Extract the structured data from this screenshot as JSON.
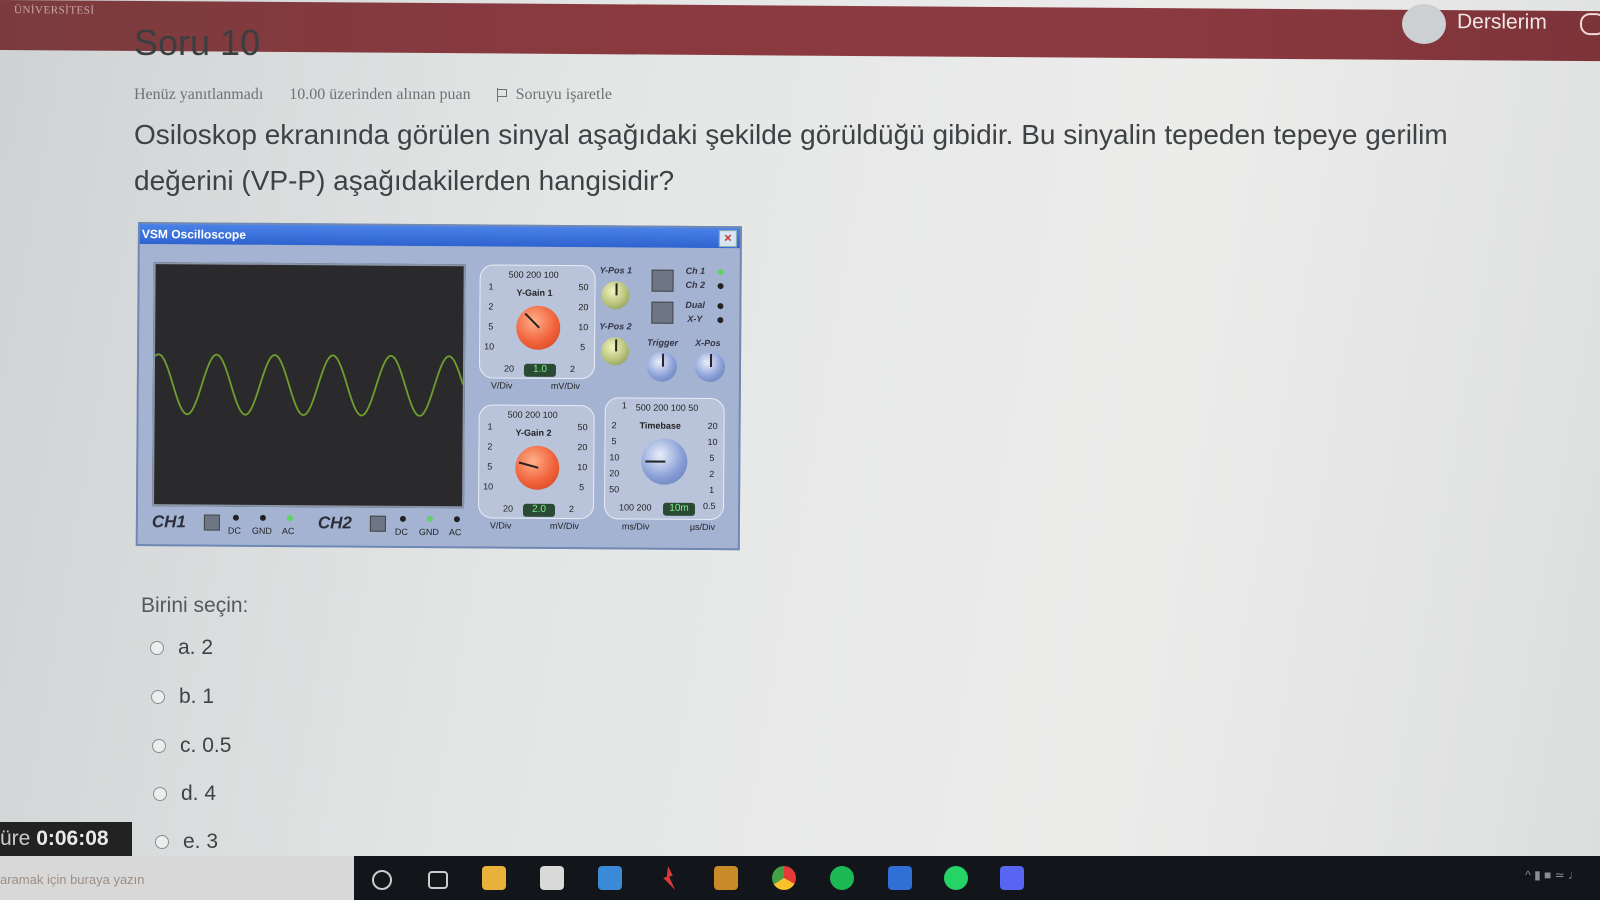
{
  "header": {
    "brand": "ÜNİVERSİTESİ",
    "user_menu": "Derslerim"
  },
  "question": {
    "title": "Soru 10",
    "status": "Henüz yanıtlanmadı",
    "points": "10.00 üzerinden alınan puan",
    "flag_label": "Soruyu işaretle",
    "text": "Osiloskop ekranında görülen sinyal aşağıdaki şekilde görüldüğü gibidir. Bu sinyalin tepeden tepeye gerilim değerini (VP-P) aşağıdakilerden hangisidir?"
  },
  "oscilloscope": {
    "title": "VSM Oscilloscope",
    "close": "×",
    "ch1_label": "CH1",
    "ch2_label": "CH2",
    "coupling": [
      "DC",
      "GND",
      "AC"
    ],
    "ygain1": {
      "label": "Y-Gain 1",
      "top_scale": "500 200 100",
      "left_ticks": [
        "1",
        "2",
        "5",
        "10",
        "20"
      ],
      "right_ticks": [
        "50",
        "20",
        "10",
        "5",
        "2"
      ],
      "readout": "1.0",
      "units_left": "V/Div",
      "units_right": "mV/Div"
    },
    "ygain2": {
      "label": "Y-Gain 2",
      "top_scale": "500 200 100",
      "left_ticks": [
        "1",
        "2",
        "5",
        "10",
        "20"
      ],
      "right_ticks": [
        "50",
        "20",
        "10",
        "5",
        "2"
      ],
      "readout": "2.0",
      "units_left": "V/Div",
      "units_right": "mV/Div"
    },
    "timebase": {
      "label": "Timebase",
      "top_scale": "500 200 100 50",
      "left_ticks": [
        "1",
        "2",
        "5",
        "10",
        "20",
        "50"
      ],
      "right_ticks": [
        "20",
        "10",
        "5",
        "2",
        "1",
        "0.5"
      ],
      "bottom_scale": "100 200",
      "readout": "10m",
      "units_left": "ms/Div",
      "units_right": "µs/Div"
    },
    "ypos1": "Y-Pos 1",
    "ypos2": "Y-Pos 2",
    "ch1_sel": "Ch 1",
    "ch2_sel": "Ch 2",
    "dual": "Dual",
    "xy": "X-Y",
    "trigger": "Trigger",
    "xpos": "X-Pos",
    "waveform_color": "#6f9e2f"
  },
  "answers": {
    "prompt": "Birini seçin:",
    "options": [
      {
        "letter": "a.",
        "value": "2"
      },
      {
        "letter": "b.",
        "value": "1"
      },
      {
        "letter": "c.",
        "value": "0.5"
      },
      {
        "letter": "d.",
        "value": "4"
      },
      {
        "letter": "e.",
        "value": "3"
      }
    ]
  },
  "timer": {
    "label": "üre",
    "value": "0:06:08"
  },
  "footer_hint": "aramak için buraya yazın",
  "colors": {
    "topbar": "#8a3a3f",
    "accent": "#2f63d0"
  }
}
